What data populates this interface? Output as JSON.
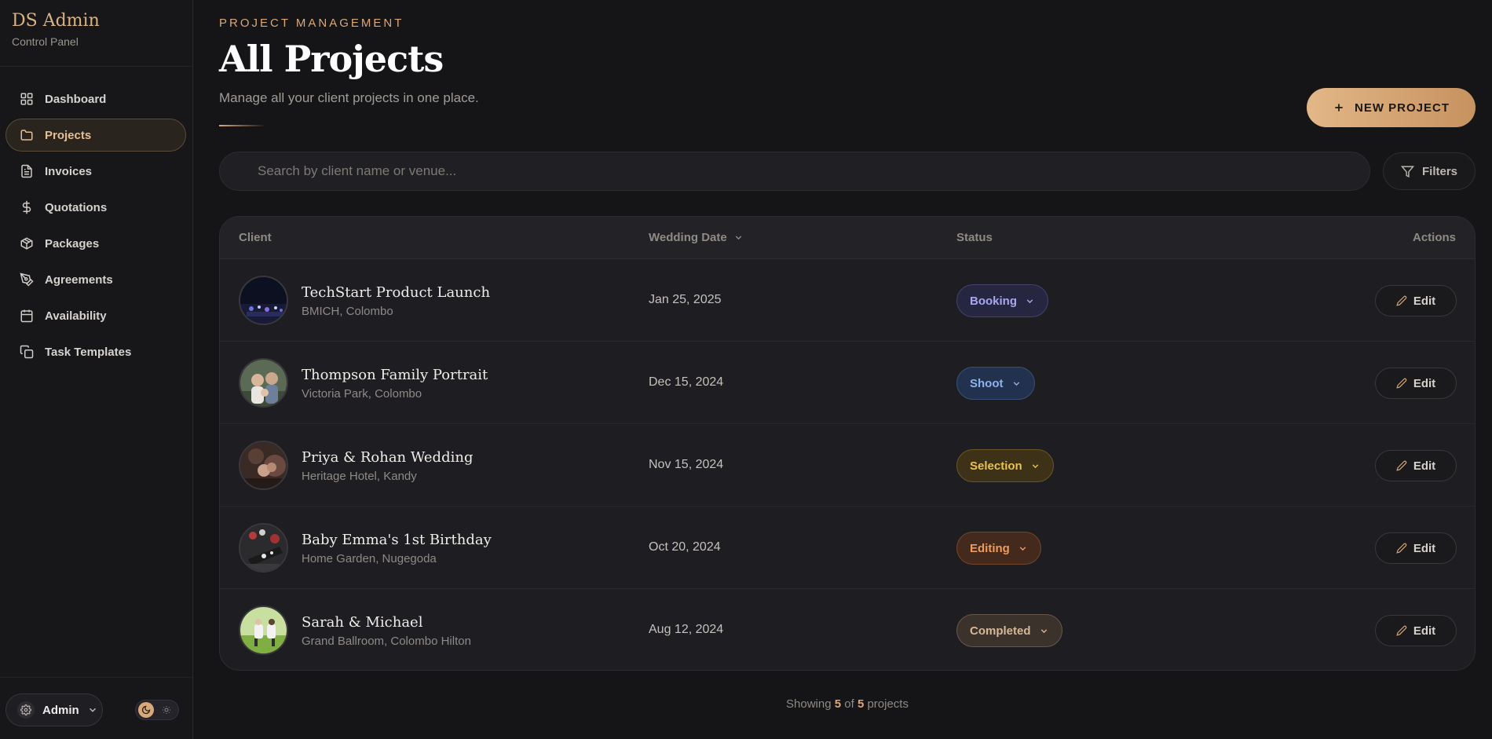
{
  "brand": {
    "title": "DS Admin",
    "subtitle": "Control Panel"
  },
  "sidebar": {
    "items": [
      {
        "label": "Dashboard",
        "icon": "grid-icon",
        "active": false
      },
      {
        "label": "Projects",
        "icon": "folder-icon",
        "active": true
      },
      {
        "label": "Invoices",
        "icon": "file-text-icon",
        "active": false
      },
      {
        "label": "Quotations",
        "icon": "dollar-icon",
        "active": false
      },
      {
        "label": "Packages",
        "icon": "package-icon",
        "active": false
      },
      {
        "label": "Agreements",
        "icon": "pen-icon",
        "active": false
      },
      {
        "label": "Availability",
        "icon": "calendar-icon",
        "active": false
      },
      {
        "label": "Task Templates",
        "icon": "copy-icon",
        "active": false
      }
    ],
    "user_label": "Admin"
  },
  "header": {
    "eyebrow": "PROJECT MANAGEMENT",
    "title": "All Projects",
    "description": "Manage all your client projects in one place.",
    "new_button": "NEW PROJECT"
  },
  "search": {
    "placeholder": "Search by client name or venue...",
    "filters_label": "Filters"
  },
  "table": {
    "columns": {
      "client": "Client",
      "date": "Wedding Date",
      "status": "Status",
      "actions": "Actions"
    },
    "edit_label": "Edit",
    "rows": [
      {
        "name": "TechStart Product Launch",
        "venue": "BMICH, Colombo",
        "date": "Jan 25, 2025",
        "status": "Booking"
      },
      {
        "name": "Thompson Family Portrait",
        "venue": "Victoria Park, Colombo",
        "date": "Dec 15, 2024",
        "status": "Shoot"
      },
      {
        "name": "Priya & Rohan Wedding",
        "venue": "Heritage Hotel, Kandy",
        "date": "Nov 15, 2024",
        "status": "Selection"
      },
      {
        "name": "Baby Emma's 1st Birthday",
        "venue": "Home Garden, Nugegoda",
        "date": "Oct 20, 2024",
        "status": "Editing"
      },
      {
        "name": "Sarah & Michael",
        "venue": "Grand Ballroom, Colombo Hilton",
        "date": "Aug 12, 2024",
        "status": "Completed"
      }
    ]
  },
  "footer": {
    "prefix": "Showing",
    "shown": "5",
    "of": "of",
    "total": "5",
    "suffix": "projects"
  },
  "colors": {
    "accent": "#d9a878",
    "booking": "#a9a6f0",
    "shoot": "#8fb2ec",
    "selection": "#e9c24f",
    "editing": "#ee9c5c",
    "completed": "#d6b796"
  }
}
